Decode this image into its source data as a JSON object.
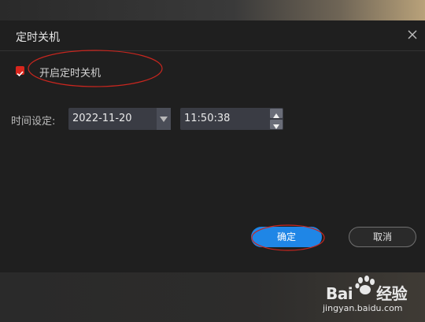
{
  "dialog": {
    "title": "定时关机",
    "enable_label": "开启定时关机",
    "enable_checked": true,
    "time_label": "时间设定:",
    "date_value": "2022-11-20",
    "time_value": "11:50:38",
    "ok_label": "确定",
    "cancel_label": "取消"
  },
  "watermark": {
    "logo_text": "Bai",
    "logo_suffix": "经验",
    "url": "jingyan.baidu.com"
  },
  "colors": {
    "accent": "#1f86e6",
    "checkbox": "#d8261d",
    "annotation": "#c8261f"
  }
}
